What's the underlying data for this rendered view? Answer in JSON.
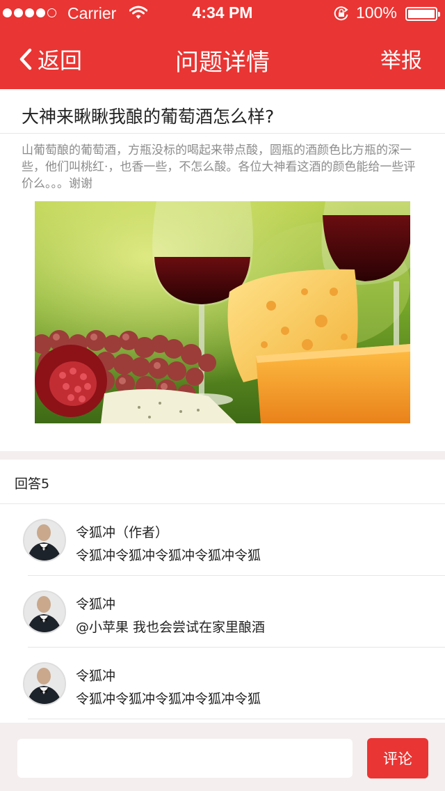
{
  "status_bar": {
    "carrier": "Carrier",
    "time": "4:34 PM",
    "battery": "100%",
    "signal_bars_filled": 4,
    "signal_bars_total": 5
  },
  "nav": {
    "back_label": "返回",
    "title": "问题详情",
    "report_label": "举报"
  },
  "question": {
    "title": "大神来瞅瞅我酿的葡萄酒怎么样?",
    "body": "山葡萄酿的葡萄酒，方瓶没标的喝起来带点酸，圆瓶的酒颜色比方瓶的深一些，他们叫桃红·，也香一些，不怎么酸。各位大神看这酒的颜色能给一些评价么。。。谢谢"
  },
  "answers": {
    "count_label": "回答5",
    "items": [
      {
        "name": "令狐冲（作者）",
        "text": "令狐冲令狐冲令狐冲令狐冲令狐"
      },
      {
        "name": "令狐冲",
        "text": "@小苹果 我也会尝试在家里酿酒"
      },
      {
        "name": "令狐冲",
        "text": "令狐冲令狐冲令狐冲令狐冲令狐"
      }
    ]
  },
  "comment_bar": {
    "placeholder": "",
    "submit_label": "评论"
  },
  "colors": {
    "brand_red": "#e93533",
    "page_bg": "#f4eeee",
    "muted_text": "#8c8c8c"
  },
  "icons": [
    "wifi-icon",
    "rotation-lock-icon",
    "battery-icon",
    "back-chevron-icon",
    "avatar-icon"
  ]
}
